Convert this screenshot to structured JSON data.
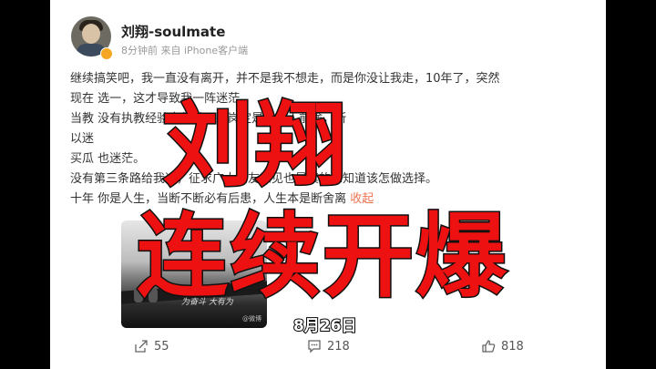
{
  "post": {
    "username": "刘翔-soulmate",
    "time": "8分钟前",
    "source": "来自 iPhone客户端",
    "lines": [
      "继续搞笑吧，我一直没有离开，并不是我不想走，而是你没让我走，10年了，突然",
      "现在                                            选一，这才导致我一阵迷茫。",
      "当教                                          没有执教经验突然就要上岗定是毁他人前途，所",
      "以迷",
      "买瓜                                         也迷茫。",
      "没有第三条路给我选，征求广大网友意见也是真的想知道该怎做选择。",
      "十年 你是人生，当断不断必有后患，人生本是断舍离"
    ],
    "more_link": "收起",
    "thumbnail_caption": "为奋斗 大有为",
    "thumbnail_watermark": "@微博"
  },
  "actions": {
    "share_count": "55",
    "comment_count": "218",
    "like_count": "818"
  },
  "overlay": {
    "title_line1": "刘翔",
    "title_line2": "连续开爆",
    "date": "8月26日"
  },
  "colors": {
    "overlay_text": "#ee1111",
    "link": "#eb7350",
    "verified_badge": "#f5a623"
  }
}
